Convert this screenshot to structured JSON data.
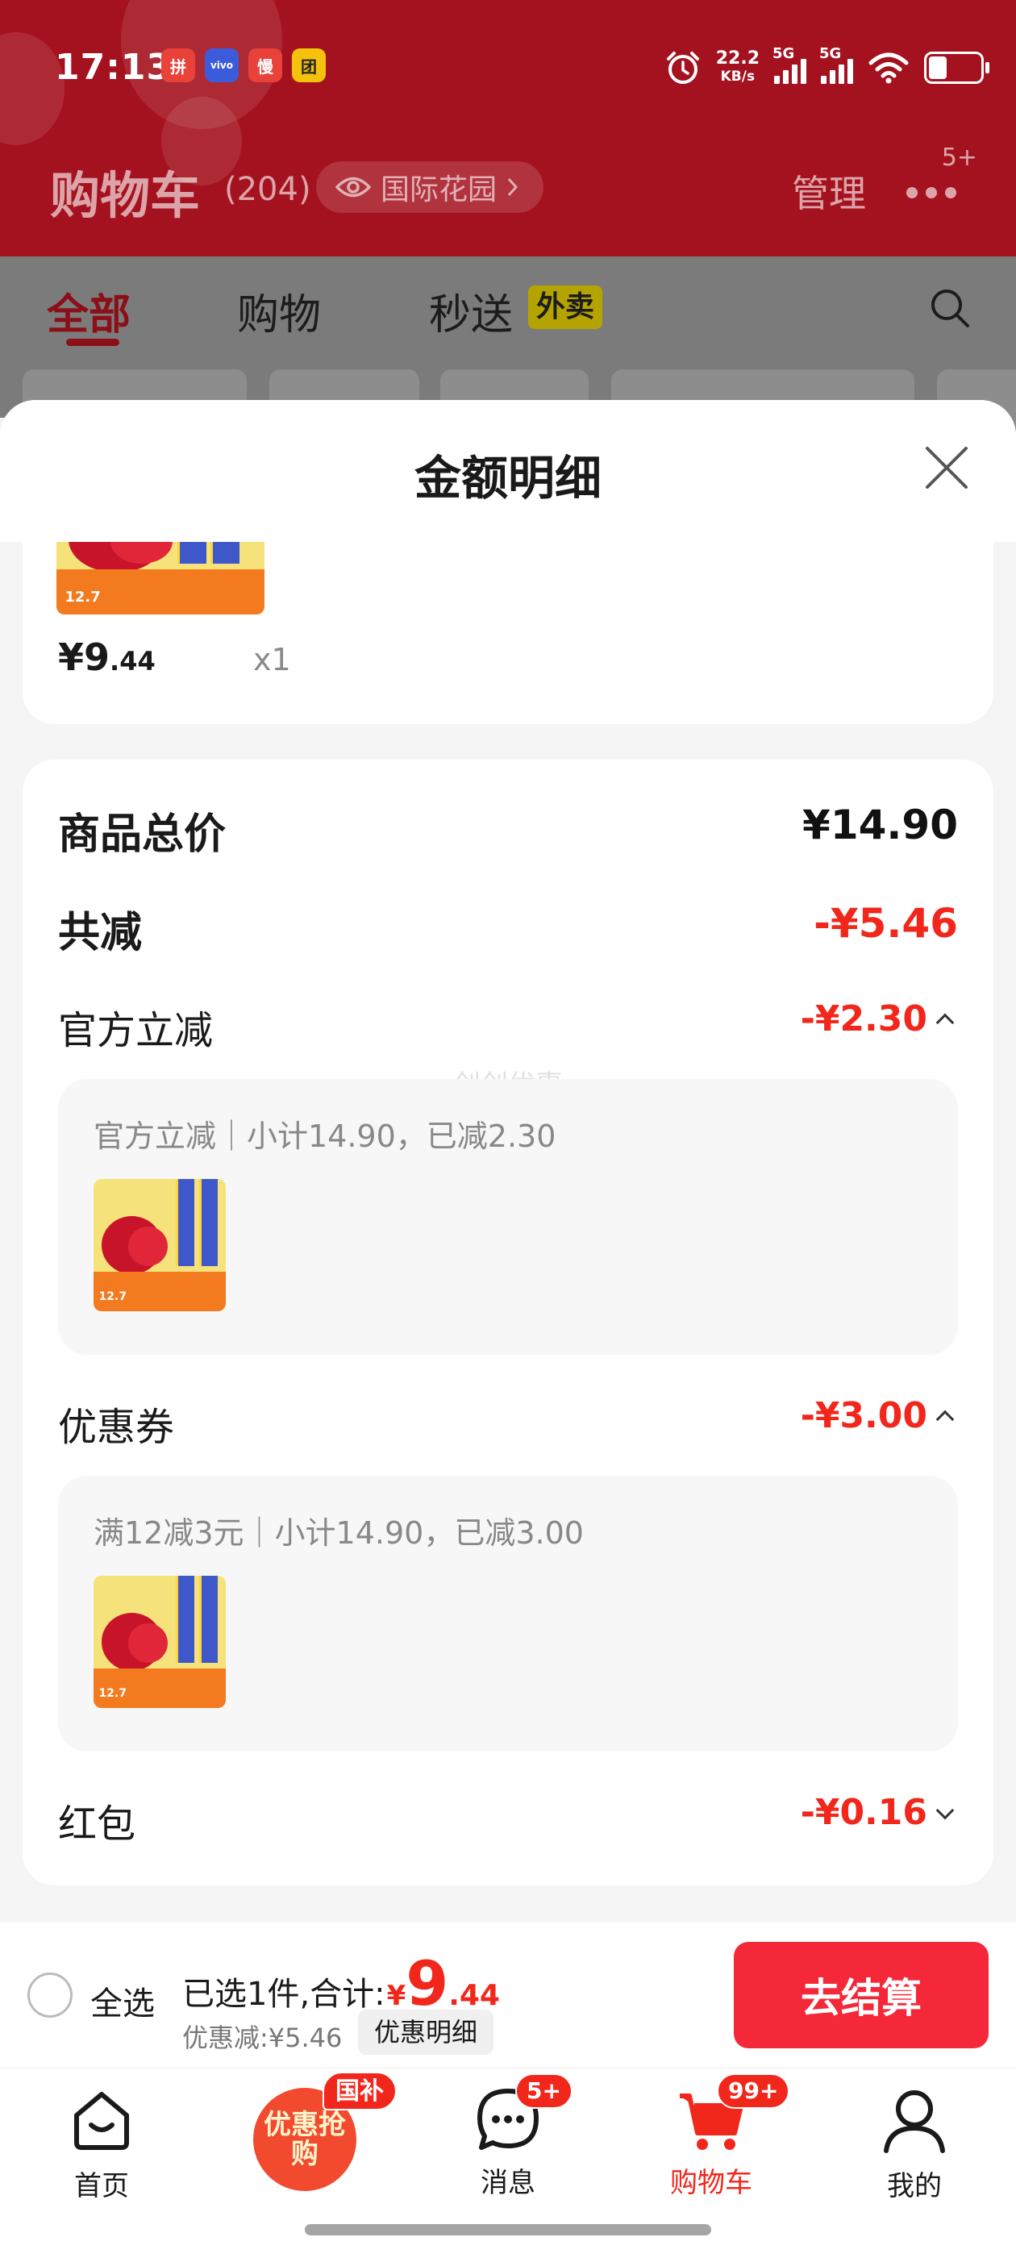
{
  "status_bar": {
    "time": "17:13",
    "app_icons": [
      {
        "label": "拼",
        "color": "#e8423a",
        "icon": "pinduoduo-icon"
      },
      {
        "label": "vivo",
        "color": "#3b5bdb",
        "icon": "vivo-icon"
      },
      {
        "label": "慢",
        "color": "#e8423a",
        "icon": "app-slow-icon"
      },
      {
        "label": "团",
        "color": "#f4c20d",
        "icon": "meituan-icon"
      }
    ],
    "net_speed_value": "22.2",
    "net_speed_unit": "KB/s",
    "signal1": "5G",
    "signal2": "5G"
  },
  "header": {
    "title": "购物车",
    "count": "(204)",
    "location": "国际花园",
    "manage": "管理",
    "more_badge": "5+"
  },
  "tabs": {
    "all": "全部",
    "shopping": "购物",
    "express": "秒送",
    "waimai": "外卖"
  },
  "sheet": {
    "title": "金额明细",
    "item_price_symbol": "¥",
    "item_price_int": "9",
    "item_price_dec": ".44",
    "item_qty": "x1",
    "total_label": "商品总价",
    "total_value": "¥14.90",
    "reduce_label": "共减",
    "reduce_value": "-¥5.46",
    "official_label": "官方立减",
    "official_value": "-¥2.30",
    "official_detail": "官方立减｜小计14.90，已减2.30",
    "watermark": "创创优惠",
    "coupon_label": "优惠券",
    "coupon_value": "-¥3.00",
    "coupon_detail": "满12减3元｜小计14.90，已减3.00",
    "redpacket_label": "红包",
    "redpacket_value": "-¥0.16"
  },
  "checkout": {
    "select_all": "全选",
    "selected_prefix": "已选1件,合计:",
    "currency": "¥",
    "total_int": "9",
    "total_dec": ".44",
    "saved": "优惠减:¥5.46",
    "detail_button": "优惠明细",
    "checkout_button": "去结算"
  },
  "bottom_nav": {
    "home": "首页",
    "promo_text": "优惠抢购",
    "promo_badge": "国补",
    "messages": "消息",
    "messages_badge": "5+",
    "cart": "购物车",
    "cart_badge": "99+",
    "mine": "我的"
  },
  "colors": {
    "header_red": "#a4121f",
    "accent_red": "#f2271c",
    "checkout_button": "#f5283a"
  }
}
